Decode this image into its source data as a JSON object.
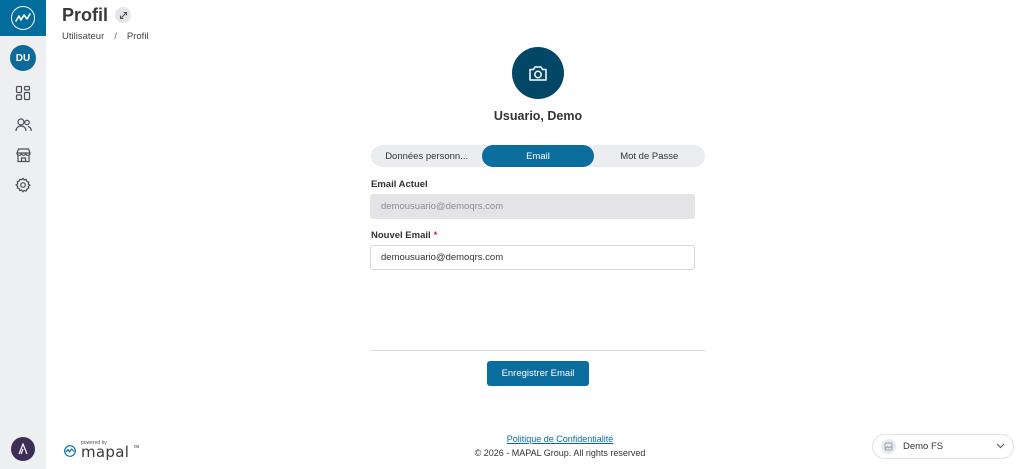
{
  "header": {
    "title": "Profil",
    "breadcrumb": [
      "Utilisateur",
      "Profil"
    ],
    "breadcrumb_sep": "/"
  },
  "sidebar": {
    "avatar_initials": "DU",
    "items": [
      {
        "icon": "dashboard-icon"
      },
      {
        "icon": "users-icon"
      },
      {
        "icon": "store-icon"
      },
      {
        "icon": "settings-icon"
      }
    ]
  },
  "profile": {
    "name": "Usuario, Demo"
  },
  "tabs": [
    {
      "label": "Données personn...",
      "active": false
    },
    {
      "label": "Email",
      "active": true
    },
    {
      "label": "Mot de Passe",
      "active": false
    }
  ],
  "form": {
    "current_email_label": "Email Actuel",
    "current_email_value": "demousuario@demoqrs.com",
    "new_email_label": "Nouvel Email",
    "new_email_required": "*",
    "new_email_value": "demousuario@demoqrs.com",
    "save_label": "Enregistrer Email"
  },
  "footer": {
    "powered_by": "powered by",
    "brand": "mapal",
    "brand_suffix": "os",
    "privacy_link": "Politique de Confidentialité",
    "copyright": "© 2026 - MAPAL Group. All rights reserved"
  },
  "company_selector": {
    "name": "Demo FS"
  },
  "colors": {
    "accent": "#0a6d9e",
    "sidebar_bg": "#eeeff1",
    "logo_bg": "#006d9c",
    "profile_pic_bg": "#024866"
  }
}
